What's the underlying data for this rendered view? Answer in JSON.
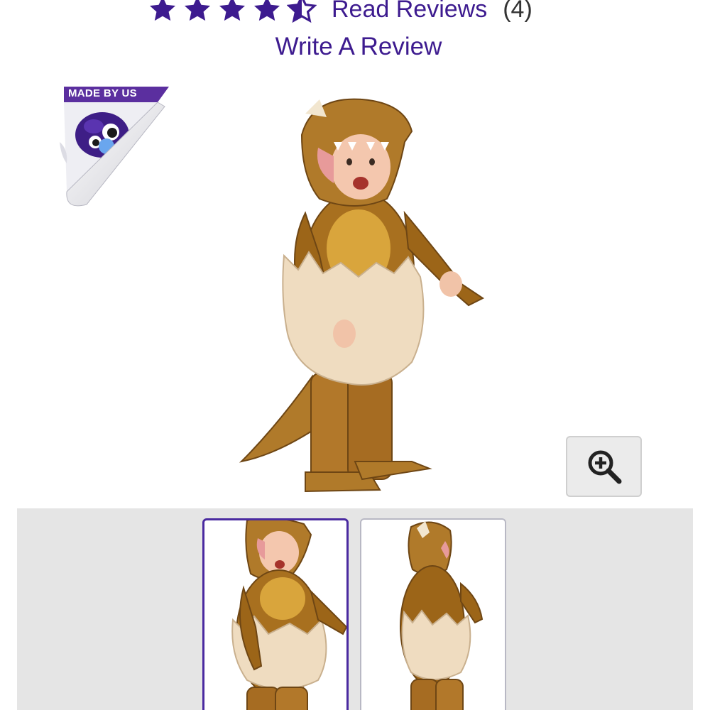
{
  "rating": {
    "stars": 4.5,
    "max_stars": 5,
    "read_reviews_label": "Read Reviews",
    "review_count": "(4)",
    "star_color": "#3d1b8f"
  },
  "write_review_label": "Write A Review",
  "badge": {
    "label": "MADE BY US",
    "color": "#5b2f9f"
  },
  "gallery": {
    "main_image_alt": "dinosaur-hatchling-costume",
    "zoom_icon": "zoom-in-icon",
    "thumbnails": [
      {
        "name": "front-view",
        "selected": true
      },
      {
        "name": "back-view",
        "selected": false
      }
    ]
  },
  "colors": {
    "link": "#3d1b8f",
    "thumb_selected_border": "#4a2aa0",
    "thumb_strip_bg": "#e5e5e5"
  }
}
